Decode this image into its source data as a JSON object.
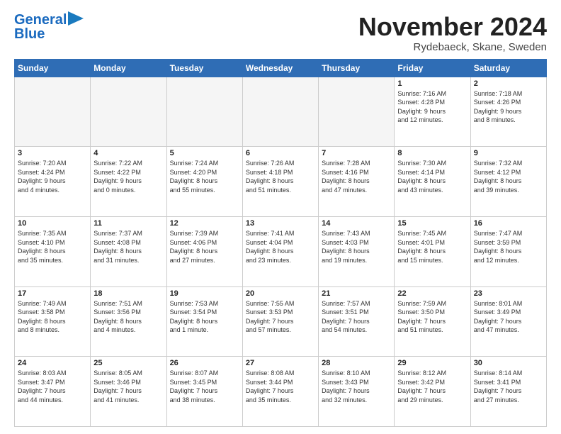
{
  "logo": {
    "line1": "General",
    "line2": "Blue"
  },
  "title": "November 2024",
  "location": "Rydebaeck, Skane, Sweden",
  "header_days": [
    "Sunday",
    "Monday",
    "Tuesday",
    "Wednesday",
    "Thursday",
    "Friday",
    "Saturday"
  ],
  "weeks": [
    [
      {
        "day": "",
        "info": ""
      },
      {
        "day": "",
        "info": ""
      },
      {
        "day": "",
        "info": ""
      },
      {
        "day": "",
        "info": ""
      },
      {
        "day": "",
        "info": ""
      },
      {
        "day": "1",
        "info": "Sunrise: 7:16 AM\nSunset: 4:28 PM\nDaylight: 9 hours\nand 12 minutes."
      },
      {
        "day": "2",
        "info": "Sunrise: 7:18 AM\nSunset: 4:26 PM\nDaylight: 9 hours\nand 8 minutes."
      }
    ],
    [
      {
        "day": "3",
        "info": "Sunrise: 7:20 AM\nSunset: 4:24 PM\nDaylight: 9 hours\nand 4 minutes."
      },
      {
        "day": "4",
        "info": "Sunrise: 7:22 AM\nSunset: 4:22 PM\nDaylight: 9 hours\nand 0 minutes."
      },
      {
        "day": "5",
        "info": "Sunrise: 7:24 AM\nSunset: 4:20 PM\nDaylight: 8 hours\nand 55 minutes."
      },
      {
        "day": "6",
        "info": "Sunrise: 7:26 AM\nSunset: 4:18 PM\nDaylight: 8 hours\nand 51 minutes."
      },
      {
        "day": "7",
        "info": "Sunrise: 7:28 AM\nSunset: 4:16 PM\nDaylight: 8 hours\nand 47 minutes."
      },
      {
        "day": "8",
        "info": "Sunrise: 7:30 AM\nSunset: 4:14 PM\nDaylight: 8 hours\nand 43 minutes."
      },
      {
        "day": "9",
        "info": "Sunrise: 7:32 AM\nSunset: 4:12 PM\nDaylight: 8 hours\nand 39 minutes."
      }
    ],
    [
      {
        "day": "10",
        "info": "Sunrise: 7:35 AM\nSunset: 4:10 PM\nDaylight: 8 hours\nand 35 minutes."
      },
      {
        "day": "11",
        "info": "Sunrise: 7:37 AM\nSunset: 4:08 PM\nDaylight: 8 hours\nand 31 minutes."
      },
      {
        "day": "12",
        "info": "Sunrise: 7:39 AM\nSunset: 4:06 PM\nDaylight: 8 hours\nand 27 minutes."
      },
      {
        "day": "13",
        "info": "Sunrise: 7:41 AM\nSunset: 4:04 PM\nDaylight: 8 hours\nand 23 minutes."
      },
      {
        "day": "14",
        "info": "Sunrise: 7:43 AM\nSunset: 4:03 PM\nDaylight: 8 hours\nand 19 minutes."
      },
      {
        "day": "15",
        "info": "Sunrise: 7:45 AM\nSunset: 4:01 PM\nDaylight: 8 hours\nand 15 minutes."
      },
      {
        "day": "16",
        "info": "Sunrise: 7:47 AM\nSunset: 3:59 PM\nDaylight: 8 hours\nand 12 minutes."
      }
    ],
    [
      {
        "day": "17",
        "info": "Sunrise: 7:49 AM\nSunset: 3:58 PM\nDaylight: 8 hours\nand 8 minutes."
      },
      {
        "day": "18",
        "info": "Sunrise: 7:51 AM\nSunset: 3:56 PM\nDaylight: 8 hours\nand 4 minutes."
      },
      {
        "day": "19",
        "info": "Sunrise: 7:53 AM\nSunset: 3:54 PM\nDaylight: 8 hours\nand 1 minute."
      },
      {
        "day": "20",
        "info": "Sunrise: 7:55 AM\nSunset: 3:53 PM\nDaylight: 7 hours\nand 57 minutes."
      },
      {
        "day": "21",
        "info": "Sunrise: 7:57 AM\nSunset: 3:51 PM\nDaylight: 7 hours\nand 54 minutes."
      },
      {
        "day": "22",
        "info": "Sunrise: 7:59 AM\nSunset: 3:50 PM\nDaylight: 7 hours\nand 51 minutes."
      },
      {
        "day": "23",
        "info": "Sunrise: 8:01 AM\nSunset: 3:49 PM\nDaylight: 7 hours\nand 47 minutes."
      }
    ],
    [
      {
        "day": "24",
        "info": "Sunrise: 8:03 AM\nSunset: 3:47 PM\nDaylight: 7 hours\nand 44 minutes."
      },
      {
        "day": "25",
        "info": "Sunrise: 8:05 AM\nSunset: 3:46 PM\nDaylight: 7 hours\nand 41 minutes."
      },
      {
        "day": "26",
        "info": "Sunrise: 8:07 AM\nSunset: 3:45 PM\nDaylight: 7 hours\nand 38 minutes."
      },
      {
        "day": "27",
        "info": "Sunrise: 8:08 AM\nSunset: 3:44 PM\nDaylight: 7 hours\nand 35 minutes."
      },
      {
        "day": "28",
        "info": "Sunrise: 8:10 AM\nSunset: 3:43 PM\nDaylight: 7 hours\nand 32 minutes."
      },
      {
        "day": "29",
        "info": "Sunrise: 8:12 AM\nSunset: 3:42 PM\nDaylight: 7 hours\nand 29 minutes."
      },
      {
        "day": "30",
        "info": "Sunrise: 8:14 AM\nSunset: 3:41 PM\nDaylight: 7 hours\nand 27 minutes."
      }
    ]
  ]
}
